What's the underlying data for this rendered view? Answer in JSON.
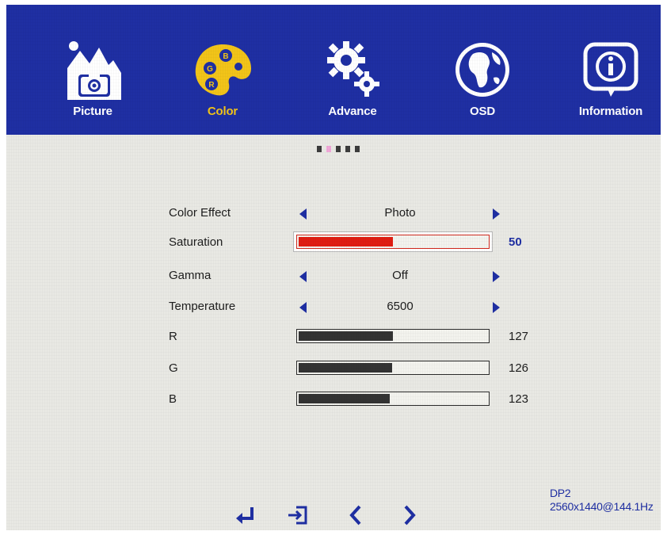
{
  "tabs": [
    {
      "label": "Picture",
      "icon": "picture-icon",
      "active": false
    },
    {
      "label": "Color",
      "icon": "color-palette-icon",
      "active": true
    },
    {
      "label": "Advance",
      "icon": "gears-icon",
      "active": false
    },
    {
      "label": "OSD",
      "icon": "globe-icon",
      "active": false
    },
    {
      "label": "Information",
      "icon": "info-icon",
      "active": false
    }
  ],
  "page_indicator": {
    "count": 5,
    "active_index": 1
  },
  "settings": {
    "color_effect": {
      "label": "Color Effect",
      "value": "Photo"
    },
    "saturation": {
      "label": "Saturation",
      "value": "50",
      "level": 50
    },
    "gamma": {
      "label": "Gamma",
      "value": "Off"
    },
    "temperature": {
      "label": "Temperature",
      "value": "6500"
    },
    "r": {
      "label": "R",
      "value": "127",
      "level": 127
    },
    "g": {
      "label": "G",
      "value": "126",
      "level": 126
    },
    "b": {
      "label": "B",
      "value": "123",
      "level": 123
    }
  },
  "bottom_nav": [
    {
      "icon": "enter-icon"
    },
    {
      "icon": "exit-icon"
    },
    {
      "icon": "chevron-left-icon"
    },
    {
      "icon": "chevron-right-icon"
    }
  ],
  "input_info": {
    "source": "DP2",
    "resolution": "2560x1440@144.1Hz"
  },
  "colors": {
    "accent_blue": "#1f2fa3",
    "active_tab": "#f2c419",
    "selected_bar": "#e01d12"
  }
}
